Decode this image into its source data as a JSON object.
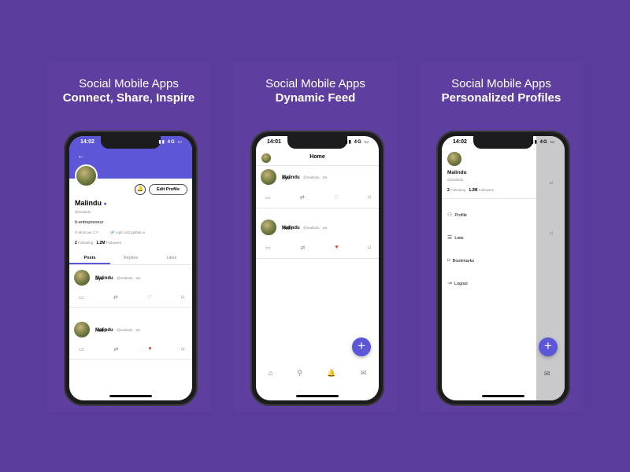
{
  "panels": [
    {
      "title": "Social Mobile Apps",
      "subtitle": "Connect, Share, Inspire"
    },
    {
      "title": "Social Mobile Apps",
      "subtitle": "Dynamic Feed"
    },
    {
      "title": "Social Mobile Apps",
      "subtitle": "Personalized Profiles"
    }
  ],
  "status": {
    "signal": "4G"
  },
  "profile": {
    "time": "14:02",
    "edit_label": "Edit Profile",
    "name": "Malindu",
    "handle": "@malindu",
    "bio": "It-entrepreneur",
    "location": "Moscow, CY",
    "link": "mpli.co/21g6fwb.io",
    "following_count": "2",
    "following_label": "Following",
    "followers_count": "1.2M",
    "followers_label": "Followers",
    "tabs": [
      "Posts",
      "Replies",
      "Likes"
    ],
    "posts": [
      {
        "name": "Malindu",
        "meta": "@malindu · 2w",
        "text": "Bye"
      },
      {
        "name": "Malindu",
        "meta": "@malindu · 2w",
        "text": "Hello"
      }
    ]
  },
  "feed": {
    "time": "14:01",
    "title": "Home",
    "posts": [
      {
        "name": "Malindu",
        "meta": "@malindu · 2w",
        "text": "Bye"
      },
      {
        "name": "Malindu",
        "meta": "@malindu · 2w",
        "text": "Hello"
      }
    ]
  },
  "drawer": {
    "time": "14:02",
    "name": "Malindu",
    "handle": "@malindu",
    "following_count": "2",
    "following_label": "Following",
    "followers_count": "1.2M",
    "followers_label": "Followers",
    "items": [
      {
        "label": "Profile",
        "icon": "user-icon"
      },
      {
        "label": "Lists",
        "icon": "list-icon"
      },
      {
        "label": "Bookmarks",
        "icon": "bookmark-icon"
      },
      {
        "label": "Logout",
        "icon": "logout-icon"
      }
    ]
  },
  "colors": {
    "background": "#5a3c9c",
    "accent": "#5d56d6",
    "like": "#e53935"
  }
}
